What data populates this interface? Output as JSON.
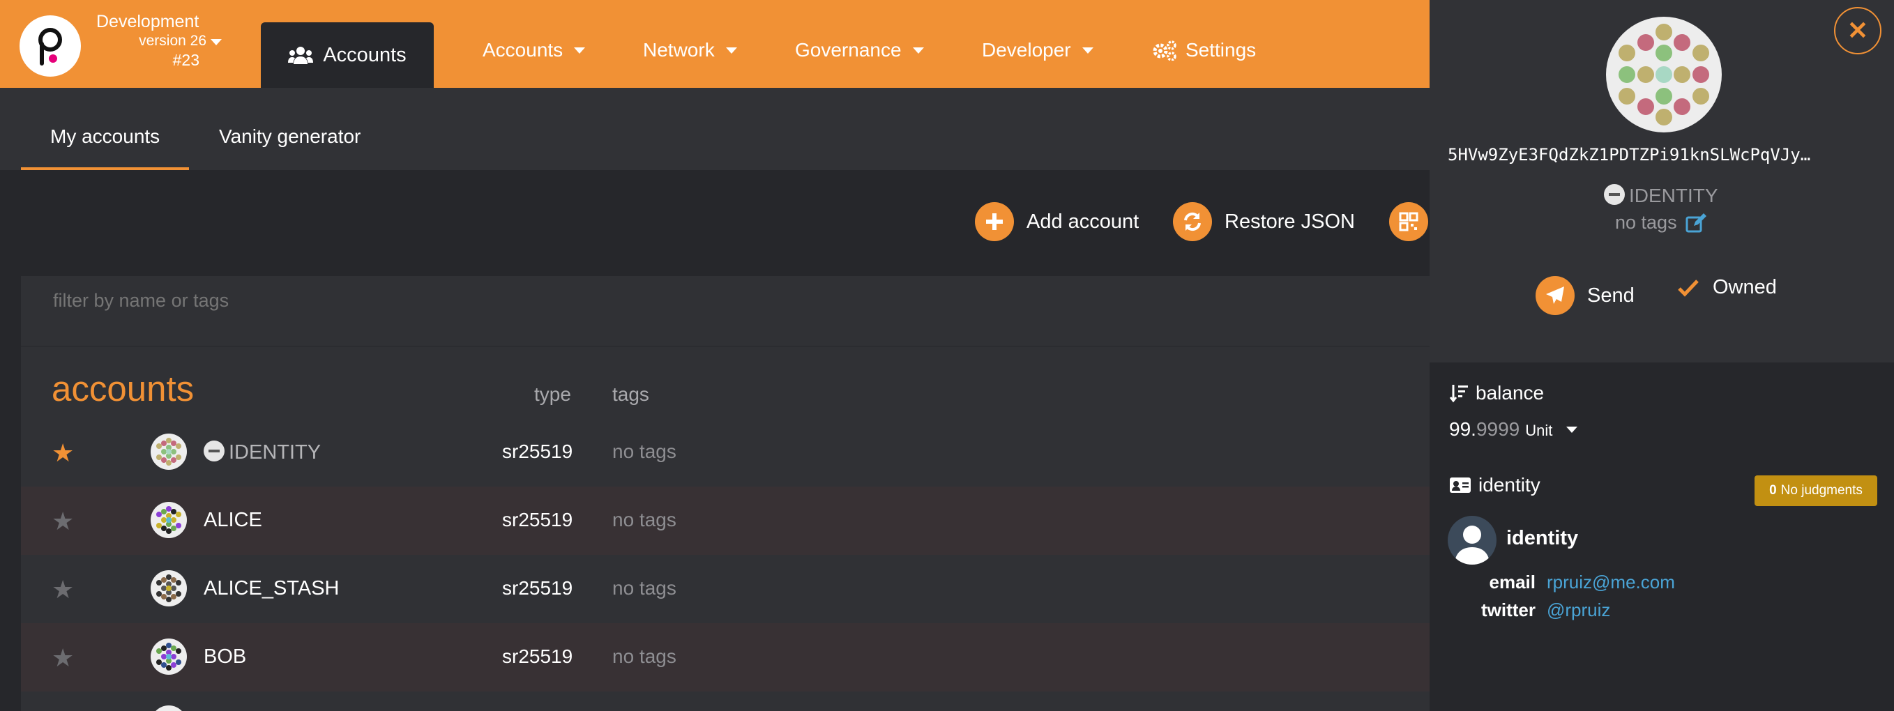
{
  "chain": {
    "name": "Development",
    "version": "version 26",
    "block": "#23"
  },
  "topnav": {
    "active_tab": "Accounts",
    "items": [
      {
        "label": "Accounts"
      },
      {
        "label": "Network"
      },
      {
        "label": "Governance"
      },
      {
        "label": "Developer"
      },
      {
        "label": "Settings"
      }
    ]
  },
  "subnav": {
    "tabs": [
      {
        "label": "My accounts"
      },
      {
        "label": "Vanity generator"
      }
    ]
  },
  "actions": {
    "add_account": "Add account",
    "restore_json": "Restore JSON"
  },
  "filter": {
    "placeholder": "filter by name or tags"
  },
  "accounts": {
    "title": "accounts",
    "col_type": "type",
    "col_tags": "tags",
    "rows": [
      {
        "name": "IDENTITY",
        "type": "sr25519",
        "tags": "no tags",
        "favorite": true
      },
      {
        "name": "ALICE",
        "type": "sr25519",
        "tags": "no tags",
        "favorite": false
      },
      {
        "name": "ALICE_STASH",
        "type": "sr25519",
        "tags": "no tags",
        "favorite": false
      },
      {
        "name": "BOB",
        "type": "sr25519",
        "tags": "no tags",
        "favorite": false
      }
    ]
  },
  "sidebar": {
    "address": "5HVw9ZyE3FQdZkZ1PDTZPi91knSLWcPqVJy…",
    "identity": "IDENTITY",
    "no_tags": "no tags",
    "send": "Send",
    "owned": "Owned",
    "balance_label": "balance",
    "balance_int": "99.",
    "balance_dec": "9999",
    "balance_unit": "Unit",
    "identity_label": "identity",
    "judgments_count": "0",
    "judgments_text": "No judgments",
    "identity_name": "identity",
    "email_key": "email",
    "email_val": "rpruiz@me.com",
    "twitter_key": "twitter",
    "twitter_val": "@rpruiz"
  },
  "colors": {
    "accent": "#f19135",
    "bg": "#26272b",
    "panel": "#303135",
    "link": "#4aa4d6",
    "badge": "#c29012"
  }
}
